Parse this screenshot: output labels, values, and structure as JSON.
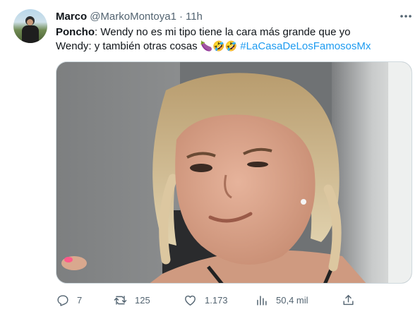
{
  "tweet": {
    "author_name": "Marco",
    "author_handle": "@MarkoMontoya1",
    "separator": "·",
    "time": "11h",
    "more_icon": "more-dots-icon",
    "lines": [
      {
        "speaker": "Poncho",
        "text": ": Wendy no es mi tipo tiene la cara más grande que yo"
      },
      {
        "text": "Wendy: y también otras cosas ",
        "emojis": "🍆🤣🤣",
        "hashtag": "#LaCasaDeLosFamososMx"
      }
    ],
    "media": {
      "type": "photo"
    },
    "stats": {
      "replies": "7",
      "retweets": "125",
      "likes": "1.173",
      "views": "50,4 mil"
    },
    "icons": {
      "reply": "reply-icon",
      "retweet": "retweet-icon",
      "like": "heart-icon",
      "views": "views-chart-icon",
      "share": "share-icon"
    },
    "colors": {
      "link": "#1d9bf0",
      "secondary_text": "#536471",
      "primary_text": "#0f1419"
    }
  }
}
